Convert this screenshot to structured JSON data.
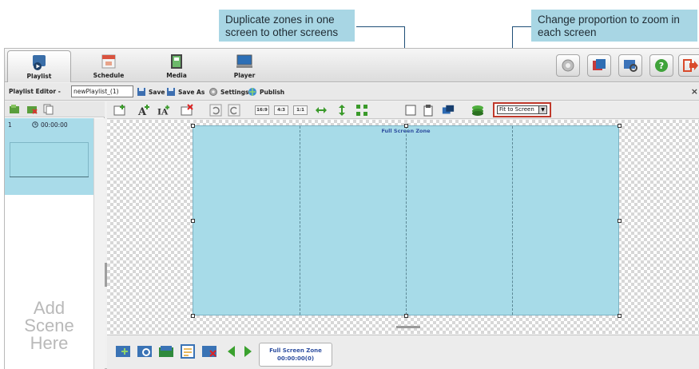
{
  "callouts": {
    "duplicate": "Duplicate zones in one screen to other screens",
    "proportion": "Change proportion to zoom in each screen"
  },
  "tabs": [
    {
      "label": "Playlist",
      "icon": "playlist-icon",
      "active": true
    },
    {
      "label": "Schedule",
      "icon": "schedule-icon"
    },
    {
      "label": "Media",
      "icon": "media-icon"
    },
    {
      "label": "Player",
      "icon": "player-icon"
    }
  ],
  "right_buttons": [
    "settings-icon",
    "slideshow-icon",
    "monitor-search-icon",
    "help-icon",
    "exit-icon"
  ],
  "editor": {
    "label": "Playlist Editor -",
    "playlist_name": "newPlaylist_(1)",
    "save": "Save",
    "save_as": "Save As",
    "settings": "Settings",
    "publish": "Publish",
    "close": "×"
  },
  "scene": {
    "number": "1",
    "time": "00:00:00",
    "add_line1": "Add",
    "add_line2": "Scene",
    "add_line3": "Here"
  },
  "toolbar": {
    "ratio_16_9": "16:9",
    "ratio_4_3": "4:3",
    "ratio_1_1": "1:1",
    "fit_select": "Fit to Screen",
    "fit_arrow": "▼"
  },
  "canvas": {
    "zone_label": "Full Screen Zone"
  },
  "bottom": {
    "zone_name": "Full Screen Zone",
    "zone_time": "00:00:00(0)"
  },
  "colors": {
    "callout_bg": "#a8d6e4",
    "zone_bg": "#a7dbe8",
    "highlight": "#c0392b"
  }
}
